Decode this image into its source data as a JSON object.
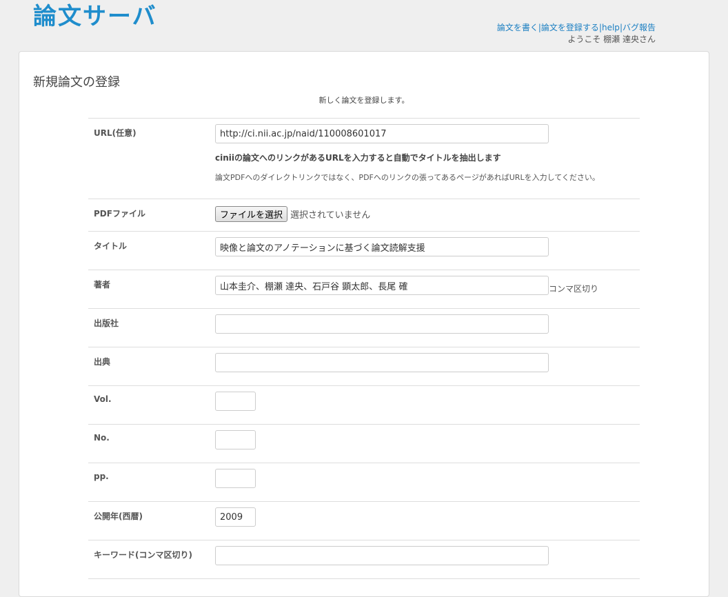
{
  "header": {
    "site_title": "論文サーバ",
    "links": [
      "論文を書く",
      "論文を登録する",
      "help",
      "バグ報告"
    ],
    "separator": "|",
    "welcome": "ようこそ 棚瀬 達央さん"
  },
  "panel": {
    "title": "新規論文の登録",
    "subtitle": "新しく論文を登録します。"
  },
  "form": {
    "url": {
      "label": "URL(任意)",
      "value": "http://ci.nii.ac.jp/naid/110008601017",
      "help_bold": "ciniiの論文へのリンクがあるURLを入力すると自動でタイトルを抽出します",
      "help": "論文PDFへのダイレクトリンクではなく、PDFへのリンクの張ってあるページがあればURLを入力してください。"
    },
    "pdf": {
      "label": "PDFファイル",
      "button": "ファイルを選択",
      "status": "選択されていません"
    },
    "title": {
      "label": "タイトル",
      "value": "映像と論文のアノテーションに基づく論文読解支援"
    },
    "authors": {
      "label": "著者",
      "value": "山本圭介、棚瀬 達央、石戸谷 顕太郎、長尾 確",
      "suffix": "コンマ区切り"
    },
    "publisher": {
      "label": "出版社",
      "value": ""
    },
    "source": {
      "label": "出典",
      "value": ""
    },
    "vol": {
      "label": "Vol.",
      "value": ""
    },
    "no": {
      "label": "No.",
      "value": ""
    },
    "pp": {
      "label": "pp.",
      "value": ""
    },
    "year": {
      "label": "公開年(西暦)",
      "value": "2009"
    },
    "keywords": {
      "label": "キーワード(コンマ区切り)",
      "value": ""
    }
  }
}
